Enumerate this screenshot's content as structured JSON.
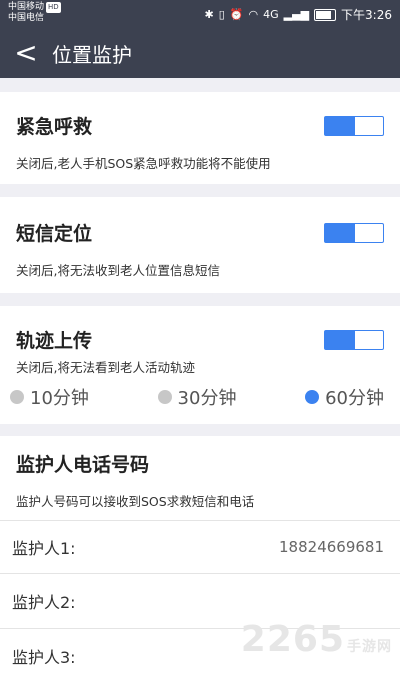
{
  "status": {
    "carrier1": "中国移动",
    "hd": "HD",
    "carrier2": "中国电信",
    "net": "4G",
    "time": "下午3:26"
  },
  "header": {
    "back_icon": "chevron-left-icon",
    "title": "位置监护"
  },
  "sections": {
    "sos": {
      "title": "紧急呼救",
      "desc": "关闭后,老人手机SOS紧急呼救功能将不能使用",
      "enabled": true
    },
    "sms": {
      "title": "短信定位",
      "desc": "关闭后,将无法收到老人位置信息短信",
      "enabled": true
    },
    "track": {
      "title": "轨迹上传",
      "desc": "关闭后,将无法看到老人活动轨迹",
      "enabled": true,
      "options": [
        {
          "label": "10分钟",
          "selected": false
        },
        {
          "label": "30分钟",
          "selected": false
        },
        {
          "label": "60分钟",
          "selected": true
        }
      ]
    }
  },
  "guardians": {
    "title": "监护人电话号码",
    "desc": "监护人号码可以接收到SOS求救短信和电话",
    "items": [
      {
        "label": "监护人1:",
        "value": "18824669681"
      },
      {
        "label": "监护人2:",
        "value": ""
      },
      {
        "label": "监护人3:",
        "value": ""
      }
    ]
  },
  "watermark": {
    "text": "2265",
    "sub": "手游网"
  }
}
